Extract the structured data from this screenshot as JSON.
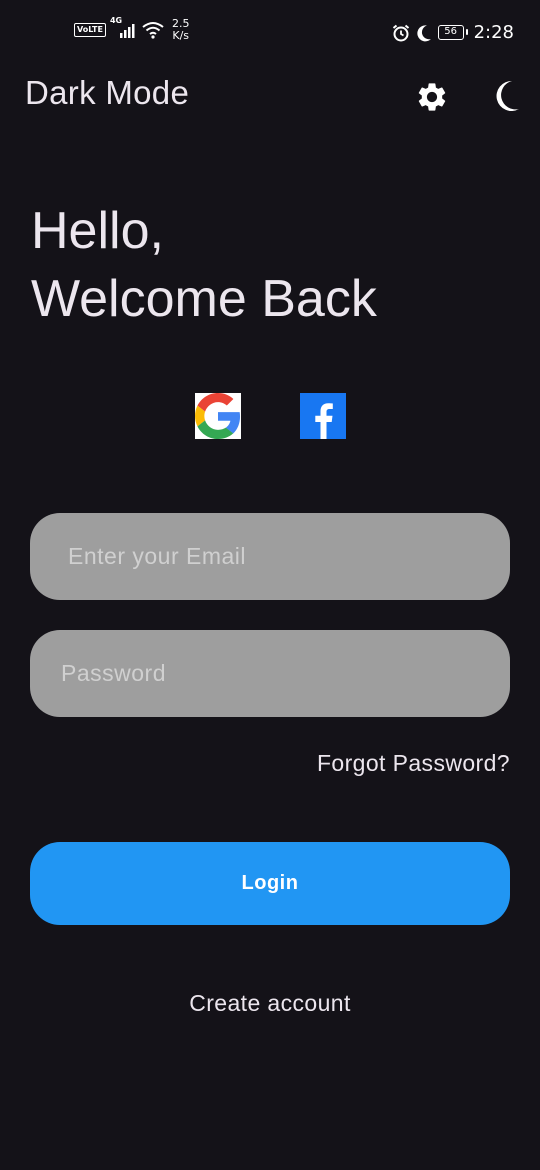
{
  "status_bar": {
    "volte": "VoLTE",
    "network_type": "4G",
    "net_speed_value": "2.5",
    "net_speed_unit": "K/s",
    "battery": "56",
    "time": "2:28"
  },
  "app_bar": {
    "title": "Dark Mode",
    "settings_icon": "gear-icon",
    "theme_icon": "moon-icon"
  },
  "headline": {
    "line1": "Hello,",
    "line2": "Welcome Back"
  },
  "social": {
    "google_icon": "google-logo",
    "facebook_icon": "facebook-logo"
  },
  "form": {
    "email_placeholder": "Enter your Email",
    "email_value": "",
    "password_placeholder": "Password",
    "password_value": "",
    "forgot_password": "Forgot Password?",
    "login_label": "Login",
    "create_account": "Create account"
  },
  "colors": {
    "background": "#141218",
    "text": "#ECE6EE",
    "input_fill": "#9E9E9E",
    "primary_button": "#2196F3",
    "facebook_blue": "#1877F2"
  }
}
